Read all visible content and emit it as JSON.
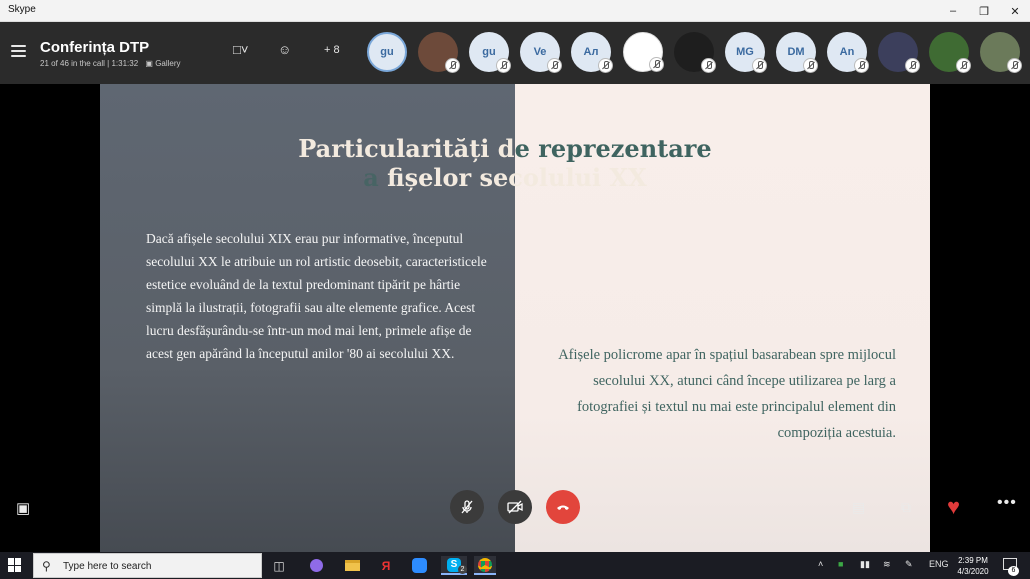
{
  "window": {
    "title": "Skype"
  },
  "call": {
    "title": "Conferința DTP",
    "subtitle": "21 of 46 in the call | 1:31:32",
    "view_label": "Gallery",
    "add_count": "8"
  },
  "participants": [
    {
      "initials": "gu",
      "photo": false,
      "selected": true
    },
    {
      "initials": "",
      "photo": true,
      "color": "#6d4a3a"
    },
    {
      "initials": "gu",
      "photo": false
    },
    {
      "initials": "Ve",
      "photo": false
    },
    {
      "initials": "Ал",
      "photo": false
    },
    {
      "initials": "",
      "photo": true,
      "color": "#ffffff"
    },
    {
      "initials": "",
      "photo": true,
      "color": "#1e1e1e"
    },
    {
      "initials": "MG",
      "photo": false
    },
    {
      "initials": "DM",
      "photo": false
    },
    {
      "initials": "An",
      "photo": false
    },
    {
      "initials": "",
      "photo": true,
      "color": "#3c3f5c"
    },
    {
      "initials": "",
      "photo": true,
      "color": "#3f6b33"
    },
    {
      "initials": "",
      "photo": true,
      "color": "#6b7a5a"
    }
  ],
  "slide": {
    "title_line1_left": "Particularități d",
    "title_line1_right": "e reprezentare",
    "title_line2_left": "a",
    "title_line2_mid": "fi",
    "title_line2_right": "șelor secolului XX",
    "left_text": "Dacă afișele secolului XIX erau pur informative, începutul secolului XX le atribuie un rol artistic deosebit, caracteristicele estetice evoluând de la textul predominant tipărit pe hârtie simplă la ilustrații, fotografii sau alte elemente grafice. Acest lucru desfășurându-se într-un mod mai lent, primele afișe de acest gen apărând la începutul anilor '80 ai secolului XX.",
    "right_text": "Afișele policrome apar în spațiul basarabean spre mijlocul secolului XX, atunci când începe utilizarea pe larg a fotografiei și textul nu mai este principalul element din compoziția acestuia."
  },
  "taskbar": {
    "search_placeholder": "Type here to search",
    "skype_badge": "2",
    "language": "ENG",
    "time": "2:39 PM",
    "date": "4/3/2020",
    "notification_count": "6"
  },
  "colors": {
    "end_call": "#e2453c",
    "like": "#e03a3a",
    "slide_accent": "#3f6460"
  }
}
